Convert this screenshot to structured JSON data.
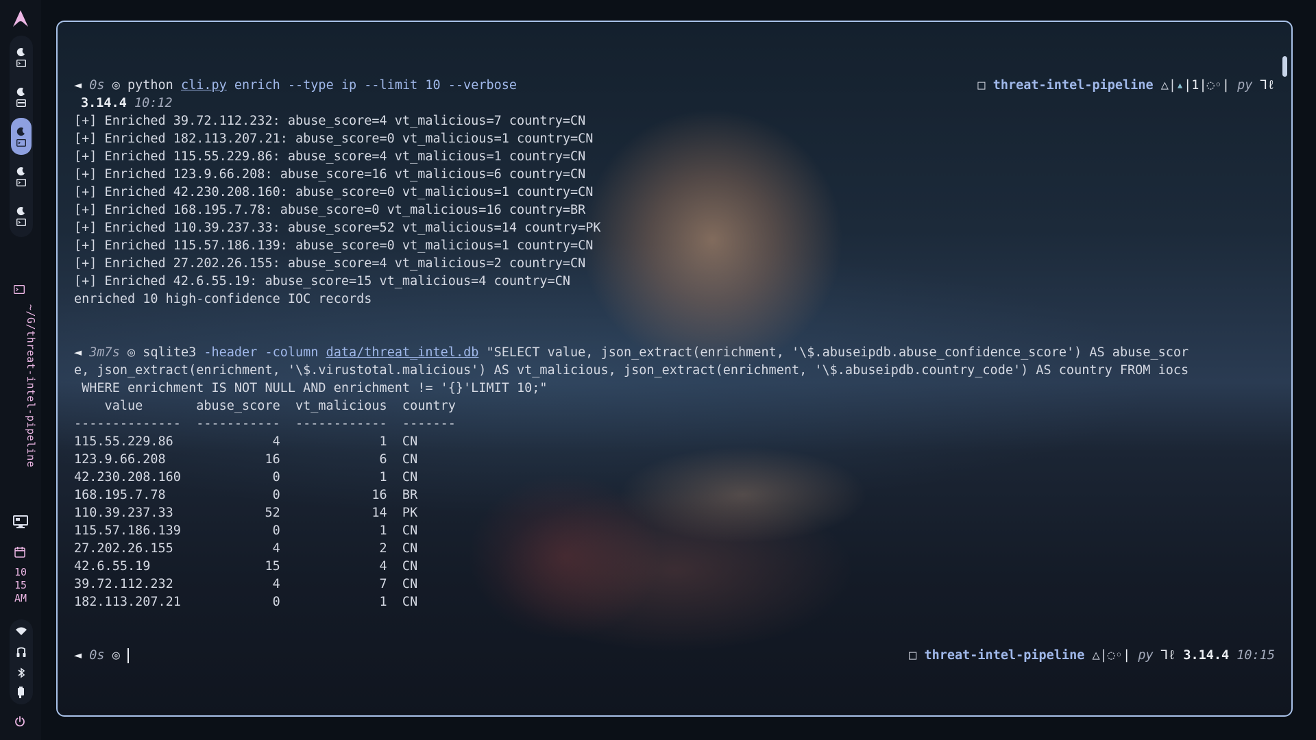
{
  "sidebar": {
    "workspaces": [
      {
        "index": 1,
        "active": false
      },
      {
        "index": 2,
        "active": false
      },
      {
        "index": 3,
        "active": true
      },
      {
        "index": 4,
        "active": false
      },
      {
        "index": 5,
        "active": false
      }
    ],
    "path": "~/G/threat-intel-pipeline",
    "clock": {
      "hour": "10",
      "minute": "15",
      "ampm": "AM"
    },
    "icons": [
      "monitor-icon",
      "calendar-icon",
      "wifi-icon",
      "audio-icon",
      "bluetooth-icon",
      "battery-icon",
      "power-icon"
    ]
  },
  "terminal": {
    "block1": {
      "prompt_symbol": "◄",
      "duration": "0s",
      "ring": "◎",
      "cmd": "python",
      "file": "cli.py",
      "args": " enrich --type ip --limit 10 --verbose",
      "right_box": "□",
      "right_repo": "threat-intel-pipeline",
      "right_git": "△|",
      "right_up": "▴",
      "right_pipe1": "|1|",
      "right_dots": "◌◦",
      "right_pipe2": "|",
      "right_lang": "py",
      "right_end": "⅂ℓ",
      "version": "3.14.4",
      "time": "10:12",
      "output": [
        "[+] Enriched 39.72.112.232: abuse_score=4 vt_malicious=7 country=CN",
        "[+] Enriched 182.113.207.21: abuse_score=0 vt_malicious=1 country=CN",
        "[+] Enriched 115.55.229.86: abuse_score=4 vt_malicious=1 country=CN",
        "[+] Enriched 123.9.66.208: abuse_score=16 vt_malicious=6 country=CN",
        "[+] Enriched 42.230.208.160: abuse_score=0 vt_malicious=1 country=CN",
        "[+] Enriched 168.195.7.78: abuse_score=0 vt_malicious=16 country=BR",
        "[+] Enriched 110.39.237.33: abuse_score=52 vt_malicious=14 country=PK",
        "[+] Enriched 115.57.186.139: abuse_score=0 vt_malicious=1 country=CN",
        "[+] Enriched 27.202.26.155: abuse_score=4 vt_malicious=2 country=CN",
        "[+] Enriched 42.6.55.19: abuse_score=15 vt_malicious=4 country=CN",
        "enriched 10 high-confidence IOC records"
      ]
    },
    "block2": {
      "prompt_symbol": "◄",
      "duration": "3m7s",
      "ring": "◎",
      "cmd": "sqlite3",
      "flags": " -header -column ",
      "file": "data/threat_intel.db",
      "query_line1": " \"SELECT value, json_extract(enrichment, '\\$.abuseipdb.abuse_confidence_score') AS abuse_scor",
      "query_line2": "e, json_extract(enrichment, '\\$.virustotal.malicious') AS vt_malicious, json_extract(enrichment, '\\$.abuseipdb.country_code') AS country FROM iocs",
      "query_line3": " WHERE enrichment IS NOT NULL AND enrichment != '{}'LIMIT 10;\"",
      "table_header": "    value       abuse_score  vt_malicious  country",
      "table_rule": "--------------  -----------  ------------  -------",
      "table_rows": [
        "115.55.229.86             4             1  CN",
        "123.9.66.208             16             6  CN",
        "42.230.208.160            0             1  CN",
        "168.195.7.78              0            16  BR",
        "110.39.237.33            52            14  PK",
        "115.57.186.139            0             1  CN",
        "27.202.26.155             4             2  CN",
        "42.6.55.19               15             4  CN",
        "39.72.112.232             4             7  CN",
        "182.113.207.21            0             1  CN"
      ]
    },
    "block3": {
      "prompt_symbol": "◄",
      "duration": "0s",
      "ring": "◎",
      "right_box": "□",
      "right_repo": "threat-intel-pipeline",
      "right_git": "△|",
      "right_dots": "◌◦",
      "right_pipe": "|",
      "right_lang": "py",
      "right_end": "⅂ℓ",
      "version": "3.14.4",
      "time": "10:15"
    }
  }
}
